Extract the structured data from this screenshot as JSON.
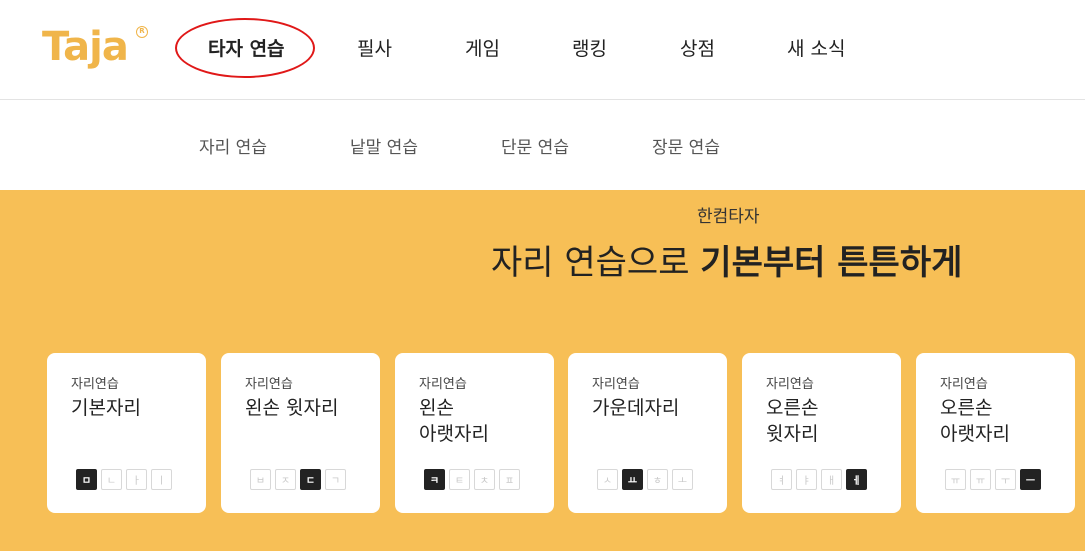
{
  "brand": {
    "logo_text": "Taja",
    "logo_mark": "R"
  },
  "nav": {
    "items": [
      {
        "label": "타자 연습",
        "active": true
      },
      {
        "label": "필사",
        "active": false
      },
      {
        "label": "게임",
        "active": false
      },
      {
        "label": "랭킹",
        "active": false
      },
      {
        "label": "상점",
        "active": false
      },
      {
        "label": "새 소식",
        "active": false
      }
    ]
  },
  "subnav": {
    "items": [
      {
        "label": "자리 연습"
      },
      {
        "label": "낱말 연습"
      },
      {
        "label": "단문 연습"
      },
      {
        "label": "장문 연습"
      }
    ]
  },
  "banner": {
    "brand": "한컴타자",
    "headline_light": "자리 연습으로 ",
    "headline_bold": "기본부터 튼튼하게"
  },
  "cards": [
    {
      "kicker": "자리연습",
      "title": "기본자리",
      "keys": [
        "ㅁ",
        "ㄴ",
        "ㅏ",
        "ㅣ"
      ],
      "active_key": 0
    },
    {
      "kicker": "자리연습",
      "title": "왼손 윗자리",
      "keys": [
        "ㅂ",
        "ㅈ",
        "ㄷ",
        "ㄱ"
      ],
      "active_key": 2
    },
    {
      "kicker": "자리연습",
      "title": "왼손\n아랫자리",
      "keys": [
        "ㅋ",
        "ㅌ",
        "ㅊ",
        "ㅍ"
      ],
      "active_key": 0
    },
    {
      "kicker": "자리연습",
      "title": "가운데자리",
      "keys": [
        "ㅅ",
        "ㅛ",
        "ㅎ",
        "ㅗ"
      ],
      "active_key": 1
    },
    {
      "kicker": "자리연습",
      "title": "오른손\n윗자리",
      "keys": [
        "ㅕ",
        "ㅑ",
        "ㅐ",
        "ㅔ"
      ],
      "active_key": 3
    },
    {
      "kicker": "자리연습",
      "title": "오른손\n아랫자리",
      "keys": [
        "ㅠ",
        "ㅠ",
        "ㅜ",
        "ㅡ"
      ],
      "active_key": 3
    }
  ],
  "colors": {
    "accent": "#f7bf56",
    "highlight": "#a6e0e2",
    "annotation": "#e01818"
  }
}
